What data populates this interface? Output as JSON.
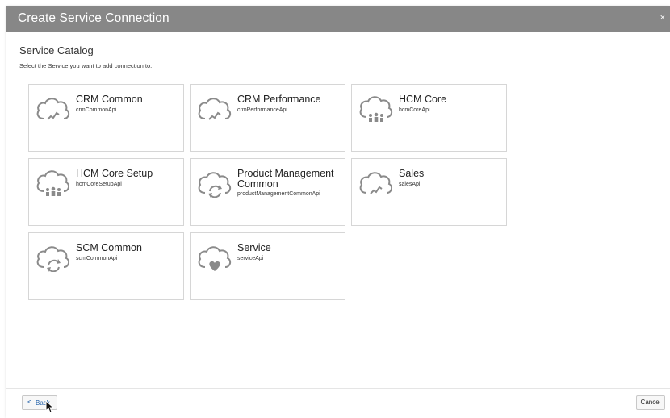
{
  "dialog": {
    "title": "Create Service Connection",
    "close_label": "×"
  },
  "catalog": {
    "title": "Service Catalog",
    "subtitle": "Select the Service you want to add connection to."
  },
  "services": [
    {
      "name": "CRM Common",
      "api": "crmCommonApi",
      "icon": "cloud-chart-icon"
    },
    {
      "name": "CRM Performance",
      "api": "crmPerformanceApi",
      "icon": "cloud-chart-icon"
    },
    {
      "name": "HCM Core",
      "api": "hcmCoreApi",
      "icon": "cloud-people-icon"
    },
    {
      "name": "HCM Core Setup",
      "api": "hcmCoreSetupApi",
      "icon": "cloud-people-icon"
    },
    {
      "name": "Product Management Common",
      "api": "productManagementCommonApi",
      "icon": "cloud-sync-icon"
    },
    {
      "name": "Sales",
      "api": "salesApi",
      "icon": "cloud-chart-icon"
    },
    {
      "name": "SCM Common",
      "api": "scmCommonApi",
      "icon": "cloud-sync-icon"
    },
    {
      "name": "Service",
      "api": "serviceApi",
      "icon": "cloud-heart-icon"
    }
  ],
  "footer": {
    "back_label": "Back",
    "back_chevron": "<",
    "cancel_label": "Cancel"
  },
  "colors": {
    "titlebar": "#878787",
    "card_border": "#d6d6d6",
    "icon_gray": "#8a8a8a",
    "link_blue": "#1f5fa8"
  }
}
